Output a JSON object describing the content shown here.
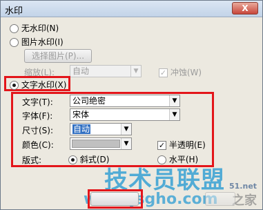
{
  "window": {
    "title": "水印",
    "close_label": "X"
  },
  "options": {
    "none_label": "无水印(N)",
    "picture_label": "图片水印(I)",
    "select_picture_label": "选择图片(P)...",
    "scale_label": "缩放(L):",
    "scale_value": "自动",
    "washout_label": "冲蚀(W)",
    "text_label": "文字水印(X)"
  },
  "text_settings": {
    "text_label": "文字(T):",
    "text_value": "公司绝密",
    "font_label": "字体(F):",
    "font_value": "宋体",
    "size_label": "尺寸(S):",
    "size_value": "自动",
    "color_label": "颜色(C):",
    "semitransparent_label": "半透明(E)",
    "layout_label": "版式:",
    "diagonal_label": "斜式(D)",
    "horizontal_label": "水平(H)"
  },
  "overlay": {
    "brand_text": "技术员联盟",
    "site_text": "www.jsgho.com",
    "side_text": "51.net",
    "corner_text": "之家"
  },
  "colors": {
    "highlight": "#e3151a",
    "selection": "#3270c2"
  }
}
